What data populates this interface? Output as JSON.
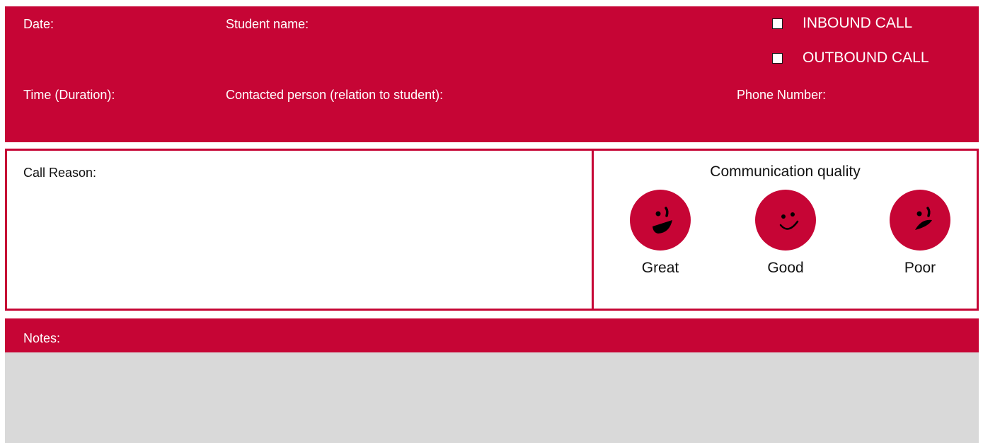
{
  "colors": {
    "accent": "#c60535",
    "notes_background": "#d9d9d9",
    "text_dark": "#111111"
  },
  "header": {
    "date_label": "Date:",
    "student_name_label": "Student name:",
    "time_label": "Time (Duration):",
    "contacted_person_label": "Contacted person (relation to student):",
    "phone_label": "Phone Number:",
    "call_types": [
      {
        "label": "INBOUND CALL",
        "checked": false
      },
      {
        "label": "OUTBOUND CALL",
        "checked": false
      }
    ]
  },
  "call_reason": {
    "label": "Call Reason:"
  },
  "communication_quality": {
    "title": "Communication quality",
    "options": [
      {
        "label": "Great",
        "icon": "laughing-face-icon"
      },
      {
        "label": "Good",
        "icon": "smiling-face-icon"
      },
      {
        "label": "Poor",
        "icon": "worried-face-icon"
      }
    ]
  },
  "notes": {
    "label": "Notes:"
  }
}
